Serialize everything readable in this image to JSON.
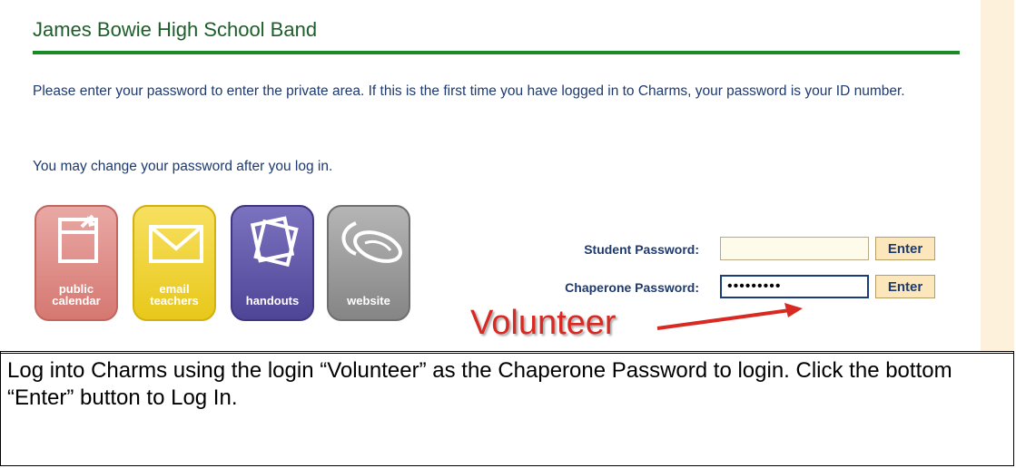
{
  "header": {
    "title": "James Bowie High School Band"
  },
  "intro": {
    "paragraph1": "Please enter your password to enter the private area. If this is the first time you have logged in to Charms, your password is your ID number.",
    "paragraph2": "You may change your password after you log in."
  },
  "tiles": [
    {
      "label_line1": "public",
      "label_line2": "calendar",
      "icon": "calendar-icon"
    },
    {
      "label_line1": "email",
      "label_line2": "teachers",
      "icon": "envelope-icon"
    },
    {
      "label_line1": "handouts",
      "label_line2": "",
      "icon": "papers-icon"
    },
    {
      "label_line1": "website",
      "label_line2": "",
      "icon": "mouse-icon"
    }
  ],
  "login": {
    "student_label": "Student Password:",
    "student_value": "",
    "chaperone_label": "Chaperone Password:",
    "chaperone_value": "•••••••••",
    "enter_label": "Enter"
  },
  "annotation": {
    "text": "Volunteer"
  },
  "instructions": {
    "text": "Log into Charms using the login “Volunteer” as the Chaperone Password to login.  Click the bottom “Enter” button to Log In."
  },
  "colors": {
    "title_green": "#1d5e2a",
    "rule_green": "#1a8a25",
    "text_blue": "#1e3a6e",
    "annotation_red": "#d82a22"
  }
}
